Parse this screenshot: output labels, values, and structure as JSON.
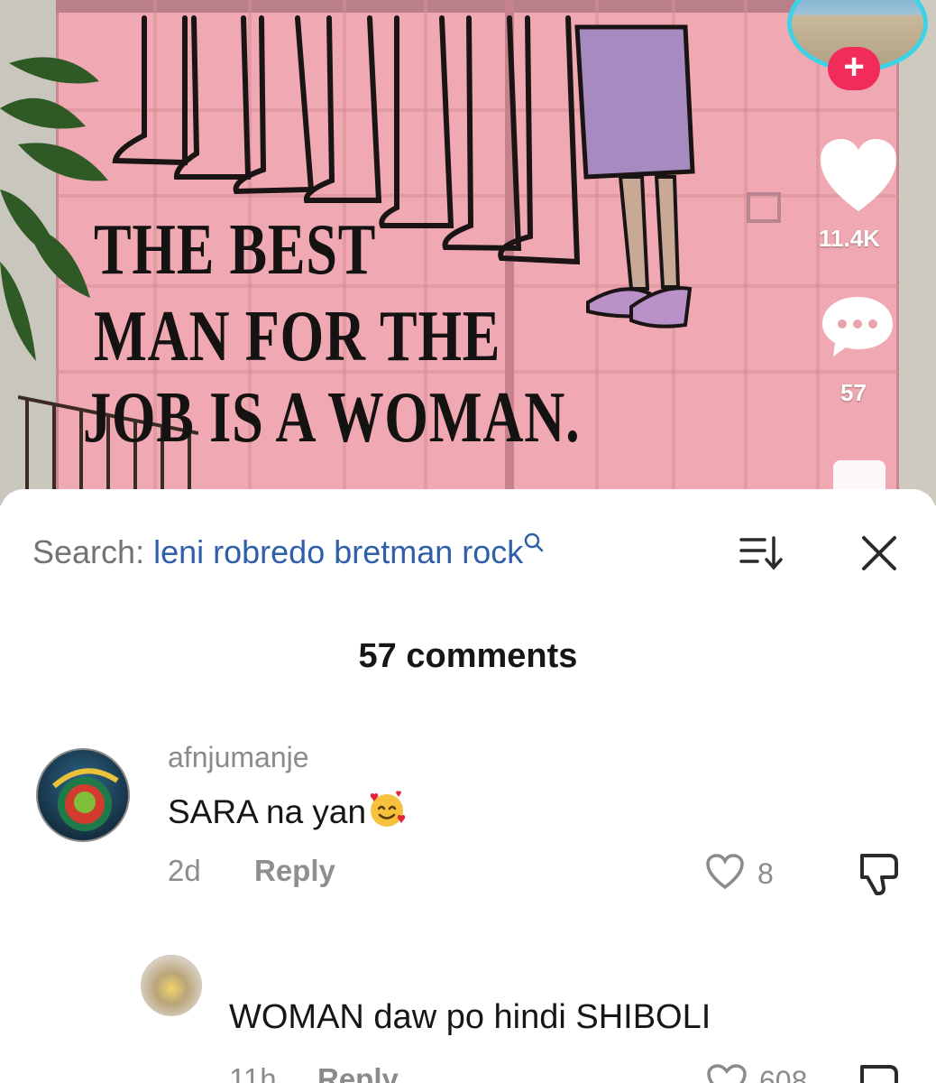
{
  "video": {
    "mural_lines": [
      "THE BEST",
      "MAN FOR THE",
      "JOB IS A WOMAN."
    ],
    "likes_count": "11.4K",
    "comments_count": "57",
    "follow_symbol": "+"
  },
  "comment_panel": {
    "search_label": "Search:",
    "search_query": "leni robredo bretman rock",
    "title": "57 comments",
    "comments": [
      {
        "username": "afnjumanje",
        "text": "SARA na yan",
        "emoji": "smiling-face-with-hearts",
        "age": "2d",
        "reply_label": "Reply",
        "likes": "8"
      },
      {
        "username": "",
        "text": "WOMAN daw po hindi SHIBOLI",
        "age": "11h",
        "reply_label": "Reply",
        "likes": "608"
      }
    ]
  },
  "colors": {
    "gate_pink": "#f0a9b2",
    "search_query_blue": "#2f5fa8",
    "follow_red": "#f12c5b",
    "avatar_ring_cyan": "#3dd3e6"
  }
}
